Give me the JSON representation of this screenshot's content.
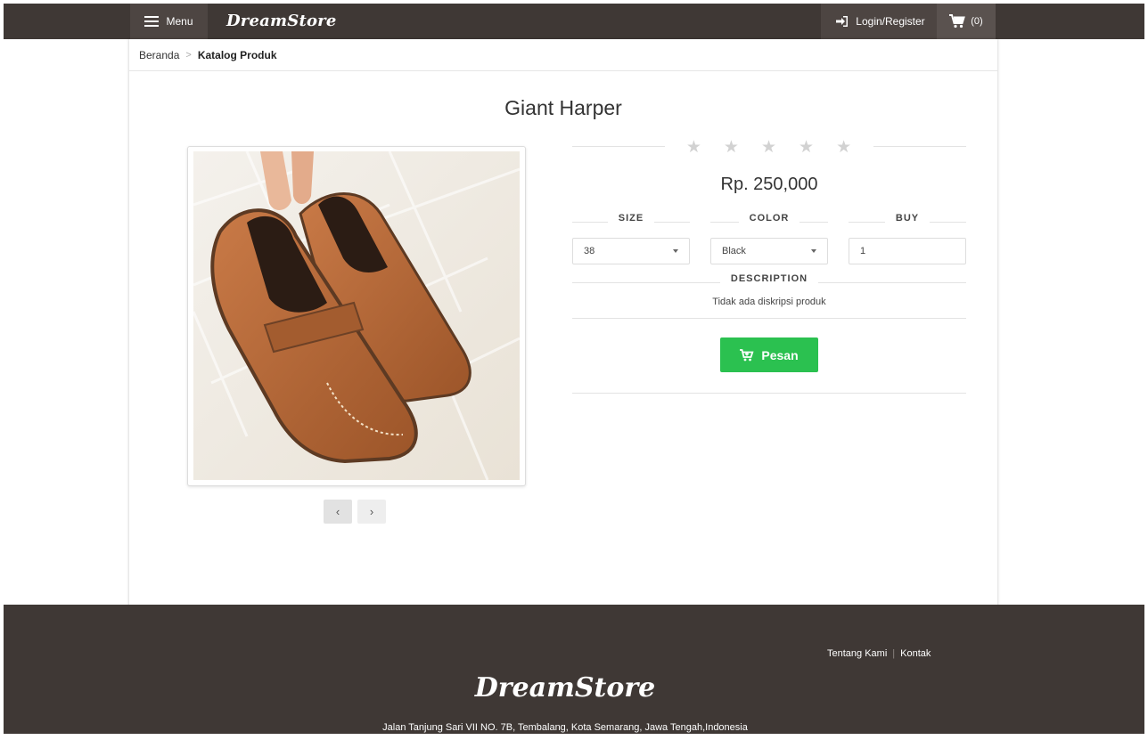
{
  "nav": {
    "menu_label": "Menu",
    "brand": "DreamStore",
    "login_label": "Login/Register",
    "cart_count": "(0)"
  },
  "breadcrumb": {
    "home": "Beranda",
    "current": "Katalog Produk"
  },
  "product": {
    "name": "Giant Harper",
    "rating": 0,
    "rating_max": 5,
    "price": "Rp. 250,000",
    "size_label": "SIZE",
    "size_value": "38",
    "color_label": "COLOR",
    "color_value": "Black",
    "buy_label": "BUY",
    "quantity": "1",
    "description_label": "DESCRIPTION",
    "description": "Tidak ada diskripsi produk",
    "order_label": "Pesan"
  },
  "gallery": {
    "prev": "‹",
    "next": "›"
  },
  "footer": {
    "about": "Tentang Kami",
    "contact": "Kontak",
    "brand": "DreamStore",
    "address": "Jalan Tanjung Sari VII NO. 7B, Tembalang, Kota Semarang, Jawa Tengah,Indonesia"
  },
  "colors": {
    "header_bg": "#3f3835",
    "accent_green": "#2bc150"
  }
}
